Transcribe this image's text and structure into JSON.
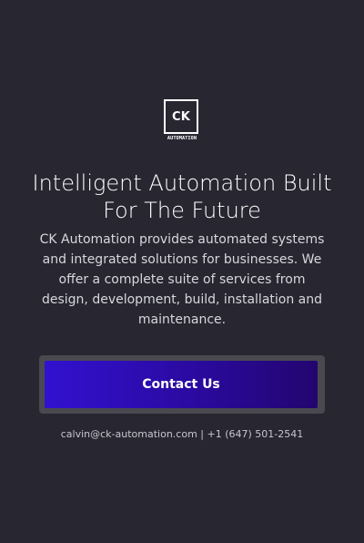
{
  "brand": {
    "logo_text": "CK",
    "logo_subtext": "AUTOMATION"
  },
  "hero": {
    "title": "Intelligent Automation Built For The Future",
    "description": "CK Automation provides automated systems and integrated solutions for businesses. We offer a complete suite of services from design, development, build, installation and maintenance.",
    "cta_label": "Contact Us"
  },
  "contact": {
    "email": "calvin@ck-automation.com",
    "separator": " | ",
    "phone": "+1 (647) 501-2541"
  },
  "colors": {
    "background": "#272631",
    "button_gradient_start": "#3211D0",
    "button_gradient_end": "#23056F",
    "button_frame": "#4A4950",
    "text": "#FFFFFF"
  }
}
